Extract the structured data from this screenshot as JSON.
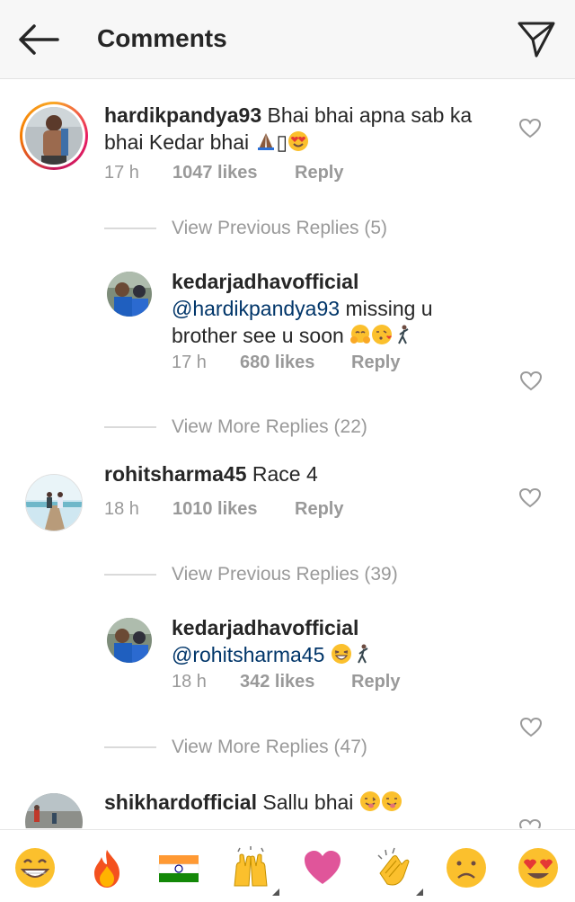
{
  "header": {
    "title": "Comments",
    "back_icon": "arrow-left-icon",
    "send_icon": "paper-plane-icon"
  },
  "comments": [
    {
      "username": "hardikpandya93",
      "text_line1": "Bhai bhai apna sab ka",
      "text_line2": "bhai Kedar bhai",
      "missing_glyph": "▯",
      "time": "17 h",
      "likes": "1047 likes",
      "reply": "Reply",
      "story_ring": true
    },
    {
      "type": "reply",
      "username": "kedarjadhavofficial",
      "mention": "@hardikpandya93",
      "text_line1": "missing u",
      "text_line2": "brother see u soon",
      "time": "17 h",
      "likes": "680 likes",
      "reply": "Reply"
    },
    {
      "username": "rohitsharma45",
      "text": "Race 4",
      "time": "18 h",
      "likes": "1010 likes",
      "reply": "Reply"
    },
    {
      "type": "reply",
      "username": "kedarjadhavofficial",
      "mention": "@rohitsharma45",
      "time": "18 h",
      "likes": "342 likes",
      "reply": "Reply"
    },
    {
      "username": "shikhardofficial",
      "text": "Sallu bhai"
    }
  ],
  "view_links": {
    "prev_1": "View Previous Replies (5)",
    "more_1": "View More Replies (22)",
    "prev_2": "View Previous Replies (39)",
    "more_2": "View More Replies (47)"
  },
  "emoji_bar": [
    "grinning-face",
    "fire",
    "india-flag",
    "raised-hands",
    "heart",
    "clapping-hands",
    "frowning-face",
    "heart-eyes-face"
  ],
  "colors": {
    "mention": "#003569",
    "muted": "#999999",
    "text": "#262626",
    "heart_emoji": "#e0559a"
  }
}
